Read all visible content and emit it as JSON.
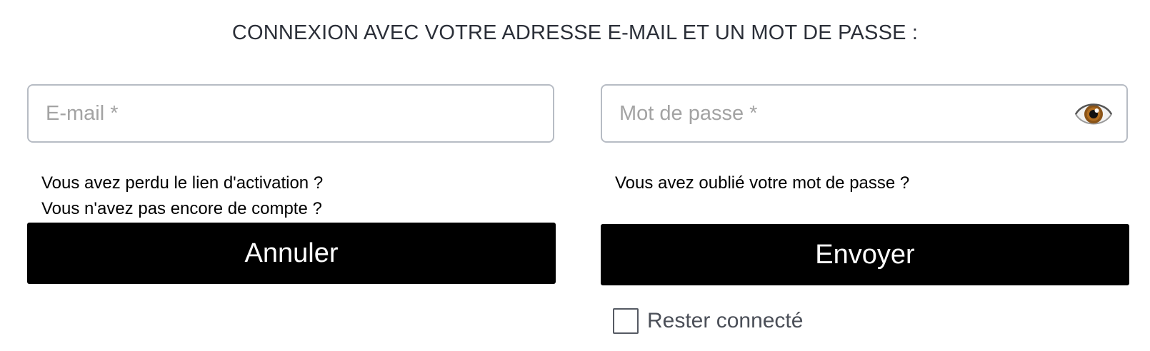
{
  "login": {
    "title": "CONNEXION AVEC VOTRE ADRESSE E-MAIL ET UN MOT DE PASSE :",
    "email": {
      "value": "",
      "placeholder": "E-mail *"
    },
    "password": {
      "value": "",
      "placeholder": "Mot de passe *",
      "toggle_icon": "eye-icon"
    },
    "links": {
      "lost_activation": "Vous avez perdu le lien d'activation ?",
      "no_account": "Vous n'avez pas encore de compte ?",
      "forgot_password": "Vous avez oublié votre mot de passe ?"
    },
    "buttons": {
      "cancel": "Annuler",
      "submit": "Envoyer"
    },
    "remember": {
      "label": "Rester connecté",
      "checked": false
    }
  },
  "colors": {
    "button_bg": "#000000",
    "button_text": "#ffffff",
    "field_border": "#b7bcc4",
    "placeholder": "#a3a3a3",
    "title": "#2b2f38"
  }
}
